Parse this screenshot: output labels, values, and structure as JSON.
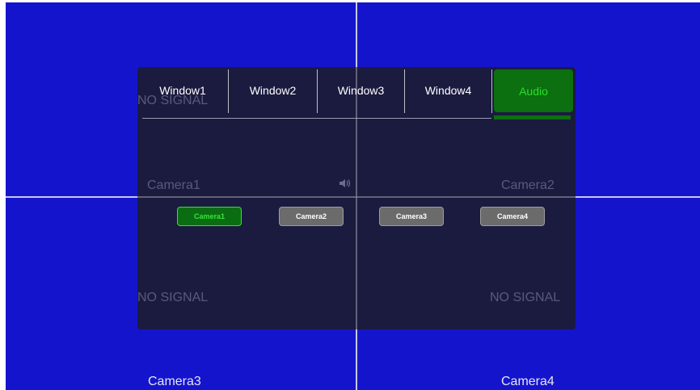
{
  "quadrants": {
    "top_left": {
      "no_signal": "NO SIGNAL",
      "camera": "Camera1"
    },
    "top_right": {
      "camera": "Camera2"
    },
    "bottom_left": {
      "no_signal": "NO SIGNAL",
      "camera": "Camera3"
    },
    "bottom_right": {
      "no_signal": "NO SIGNAL",
      "camera": "Camera4"
    }
  },
  "menu": {
    "tabs": [
      {
        "label": "Window1"
      },
      {
        "label": "Window2"
      },
      {
        "label": "Window3"
      },
      {
        "label": "Window4"
      },
      {
        "label": "Audio",
        "active": true
      }
    ],
    "audio_sources": [
      {
        "label": "Camera1",
        "active": true
      },
      {
        "label": "Camera2"
      },
      {
        "label": "Camera3"
      },
      {
        "label": "Camera4"
      }
    ]
  },
  "colors": {
    "screen_background": "#1414cc",
    "menu_background": "#1c1c3a",
    "active_green": "#0c6f10",
    "active_text": "#27e02a",
    "button_gray": "#6b6b6b"
  },
  "icons": {
    "speaker": "speaker-icon"
  }
}
